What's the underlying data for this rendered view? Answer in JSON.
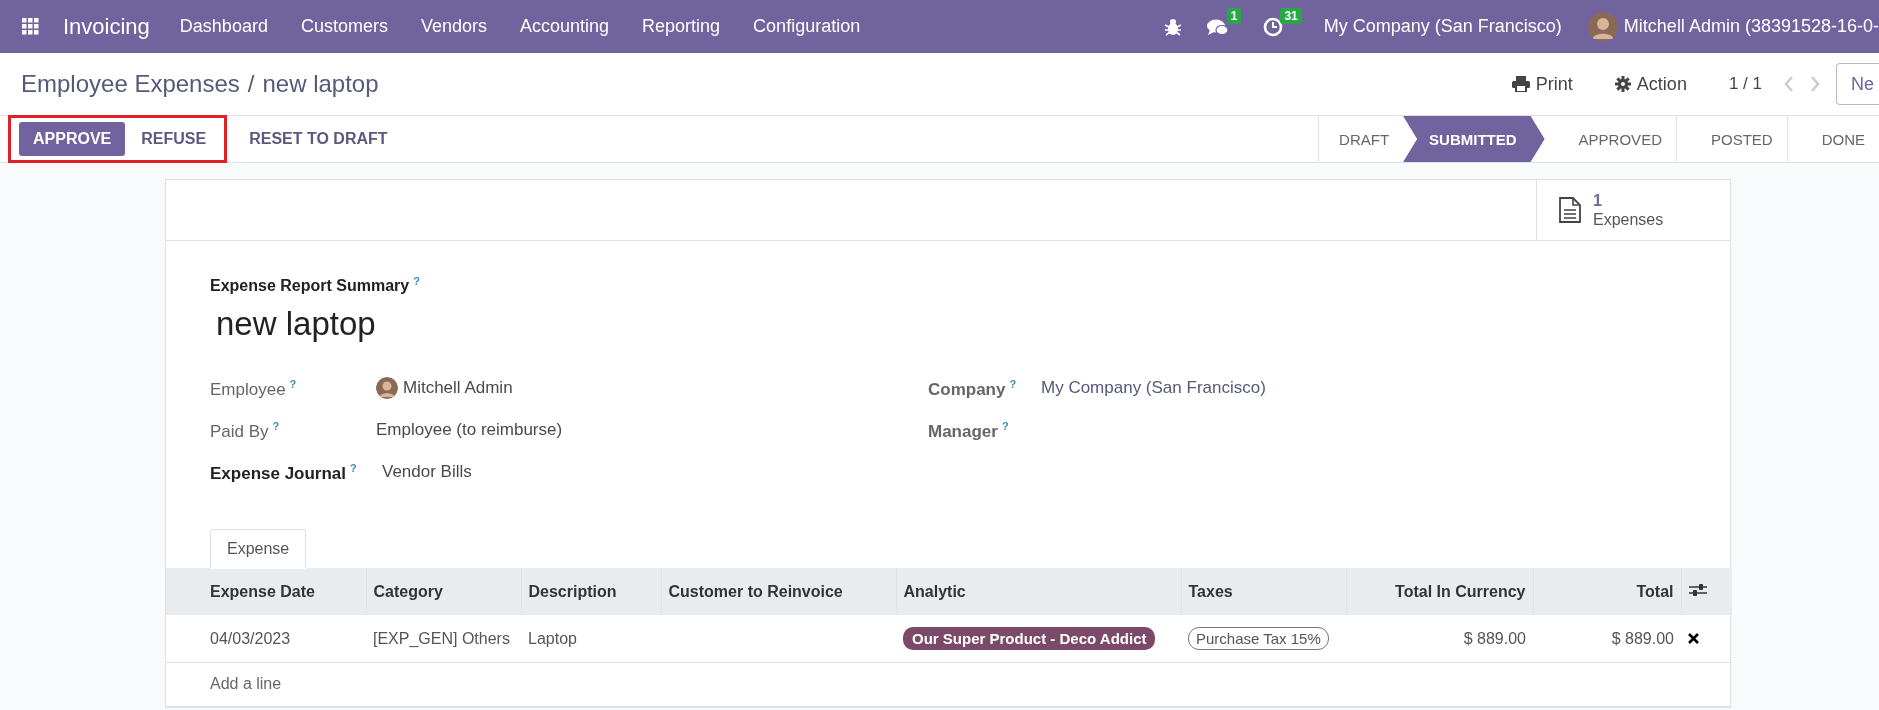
{
  "navbar": {
    "app_name": "Invoicing",
    "menu": [
      "Dashboard",
      "Customers",
      "Vendors",
      "Accounting",
      "Reporting",
      "Configuration"
    ],
    "messages_badge": "1",
    "activities_badge": "31",
    "company": "My Company (San Francisco)",
    "user": "Mitchell Admin (38391528-16-0-"
  },
  "breadcrumb": {
    "parent": "Employee Expenses",
    "separator": "/",
    "current": "new laptop"
  },
  "toolbar": {
    "print": "Print",
    "action": "Action",
    "pager": "1 / 1",
    "new_button": "Ne"
  },
  "actions": {
    "highlighted": true,
    "buttons": [
      {
        "label": "APPROVE",
        "primary": true
      },
      {
        "label": "REFUSE",
        "primary": false
      },
      {
        "label": "RESET TO DRAFT",
        "primary": false
      }
    ]
  },
  "status_steps": [
    {
      "label": "DRAFT",
      "selected": false
    },
    {
      "label": "SUBMITTED",
      "selected": true
    },
    {
      "label": "APPROVED",
      "selected": false
    },
    {
      "label": "POSTED",
      "selected": false
    },
    {
      "label": "DONE",
      "selected": false
    }
  ],
  "smart_button": {
    "count": "1",
    "label": "Expenses"
  },
  "form": {
    "title_label": "Expense Report Summary",
    "help": "?",
    "title": "new laptop",
    "left_fields": [
      {
        "kind": "user",
        "label": "Employee",
        "help": "?",
        "value": "Mitchell Admin",
        "required": false
      },
      {
        "kind": "text",
        "label": "Paid By",
        "help": "?",
        "value": "Employee (to reimburse)",
        "required": false
      },
      {
        "kind": "text",
        "label": "Expense Journal",
        "help": "?",
        "value": "Vendor Bills",
        "required": true
      }
    ],
    "right_fields": [
      {
        "kind": "text",
        "label": "Company",
        "help": "?",
        "value": "My Company (San Francisco)"
      },
      {
        "kind": "empty",
        "label": "Manager",
        "help": "?"
      }
    ]
  },
  "tabs": [
    {
      "label": "Expense",
      "selected": true
    }
  ],
  "table": {
    "columns": [
      "Expense Date",
      "Category",
      "Description",
      "Customer to Reinvoice",
      "Analytic",
      "Taxes",
      "Total In Currency",
      "Total"
    ],
    "rows": [
      {
        "cells": [
          {
            "kind": "text",
            "text": "04/03/2023"
          },
          {
            "kind": "text",
            "text": "[EXP_GEN] Others"
          },
          {
            "kind": "text",
            "text": "Laptop"
          },
          {
            "kind": "empty"
          },
          {
            "kind": "tag",
            "text": "Our Super Product - Deco Addict",
            "color": "#7c4a69"
          },
          {
            "kind": "outline-tag",
            "text": "Purchase Tax 15%"
          },
          {
            "kind": "number",
            "text": "$ 889.00"
          },
          {
            "kind": "number",
            "text": "$ 889.00"
          }
        ]
      }
    ],
    "add_line": "Add a line"
  }
}
